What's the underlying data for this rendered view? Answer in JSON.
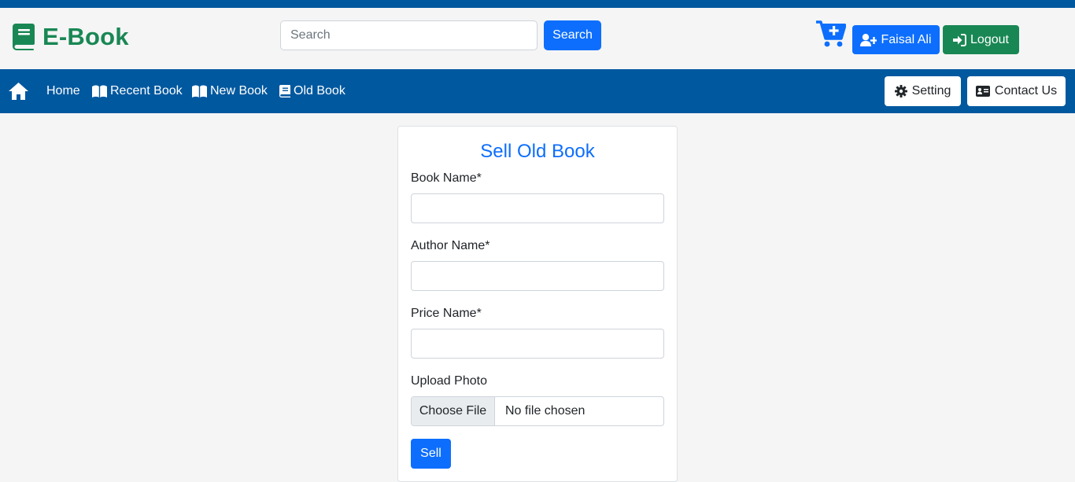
{
  "colors": {
    "primary": "#0d6efd",
    "success": "#198754",
    "navbar": "#00589f",
    "background": "#f5f5f5"
  },
  "header": {
    "brand": "E-Book",
    "brand_icon": "book-icon",
    "search_placeholder": "Search",
    "search_button": "Search",
    "cart_icon": "cart-plus-icon",
    "user_button": "Faisal Ali",
    "user_icon": "user-plus-icon",
    "logout_button": "Logout",
    "logout_icon": "sign-in-icon"
  },
  "navbar": {
    "home_icon": "home-icon",
    "items": [
      {
        "label": "Home",
        "icon": ""
      },
      {
        "label": "Recent Book",
        "icon": "open-book-icon"
      },
      {
        "label": "New Book",
        "icon": "open-book-icon"
      },
      {
        "label": "Old Book",
        "icon": "book-icon"
      }
    ],
    "setting_button": "Setting",
    "setting_icon": "gear-icon",
    "contact_button": "Contact Us",
    "contact_icon": "id-card-icon"
  },
  "form": {
    "title": "Sell Old Book",
    "book_name_label": "Book Name*",
    "author_name_label": "Author Name*",
    "price_label": "Price Name*",
    "upload_label": "Upload Photo",
    "choose_file": "Choose File",
    "file_status": "No file chosen",
    "submit": "Sell"
  }
}
